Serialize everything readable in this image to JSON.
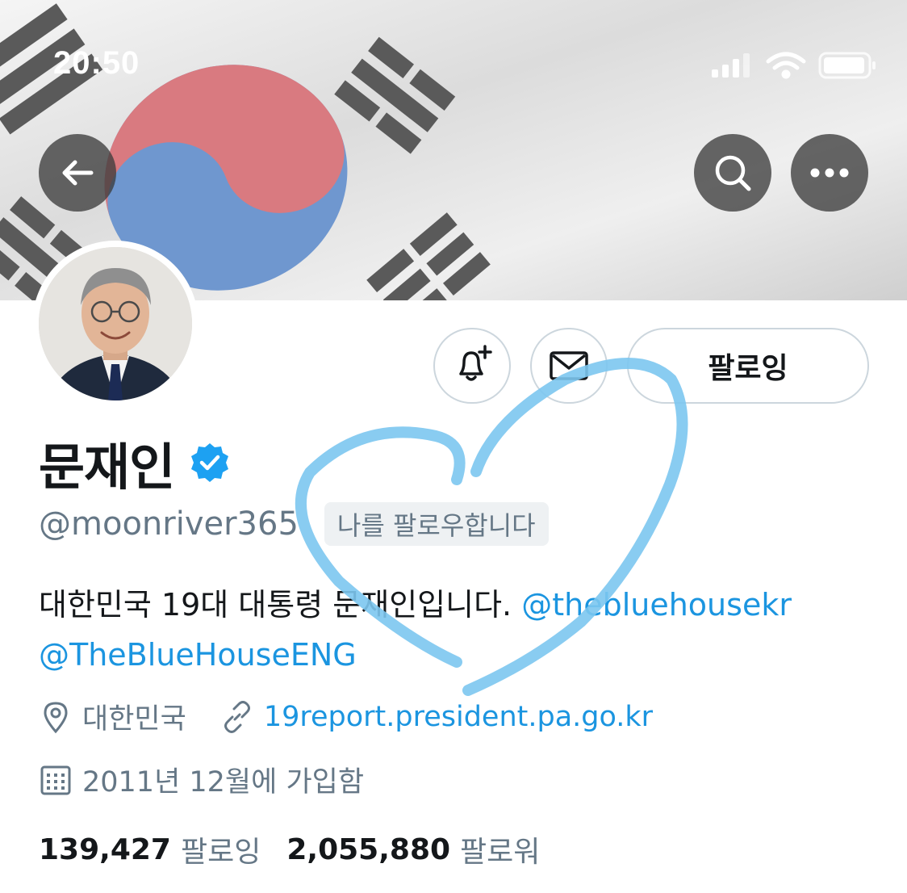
{
  "status_bar": {
    "time": "20:50"
  },
  "profile": {
    "name": "문재인",
    "handle": "@moonriver365",
    "follows_you": "나를 팔로우합니다",
    "bio_text": "대한민국 19대 대통령 문재인입니다.",
    "bio_mention_1": "@thebluehousekr",
    "bio_mention_2": "@TheBlueHouseENG",
    "location": "대한민국",
    "website": "19report.president.pa.go.kr",
    "joined": "2011년 12월에 가입함",
    "following_count": "139,427",
    "following_label": "팔로잉",
    "followers_count": "2,055,880",
    "followers_label": "팔로워"
  },
  "actions": {
    "follow_button": "팔로잉"
  },
  "icons": {
    "back": "arrow-left-icon",
    "search": "search-icon",
    "more": "more-dots-icon",
    "notify": "bell-plus-icon",
    "message": "envelope-icon",
    "verified": "verified-badge-icon",
    "location": "location-pin-icon",
    "link": "link-icon",
    "calendar": "calendar-icon"
  },
  "colors": {
    "link": "#1b95e0",
    "secondary_text": "#657786",
    "verified": "#1da1f2",
    "heart_overlay": "#7cc7f0"
  }
}
